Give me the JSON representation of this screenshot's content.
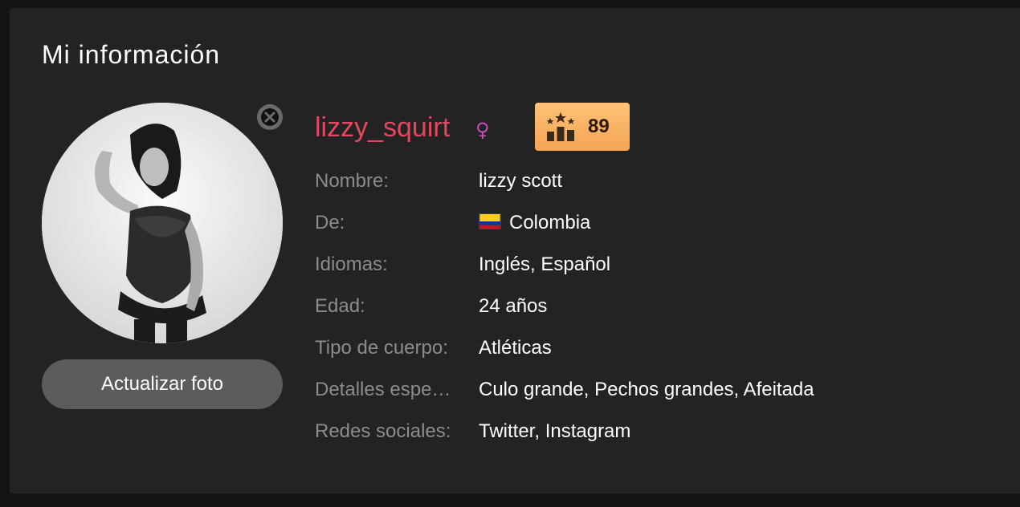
{
  "panel": {
    "title": "Mi información"
  },
  "profile": {
    "username": "lizzy_squirt",
    "gender_symbol": "♀",
    "rank": "89",
    "update_photo_label": "Actualizar foto"
  },
  "info": [
    {
      "label": "Nombre:",
      "value": "lizzy scott"
    },
    {
      "label": "De:",
      "value": "Colombia",
      "flag_colors": [
        "#FCD116",
        "#003893",
        "#CE1126"
      ]
    },
    {
      "label": "Idiomas:",
      "value": "Inglés, Español"
    },
    {
      "label": "Edad:",
      "value": "24 años"
    },
    {
      "label": "Tipo de cuerpo:",
      "value": "Atléticas"
    },
    {
      "label": "Detalles espe…",
      "value": "Culo grande, Pechos grandes, Afeitada"
    },
    {
      "label": "Redes sociales:",
      "value": "Twitter, Instagram"
    }
  ],
  "colors": {
    "username": "#e4475f",
    "gender": "#c04fb8",
    "rank_badge": "#f4a454",
    "panel_bg": "#232323"
  },
  "icons": {
    "close": "close-icon",
    "rank": "rank-podium-icon",
    "gender": "female-icon",
    "flag": "colombia-flag-icon"
  }
}
